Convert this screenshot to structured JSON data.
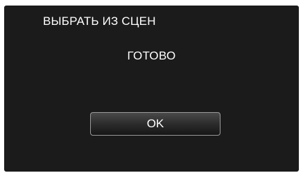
{
  "dialog": {
    "title": "ВЫБРАТЬ ИЗ СЦЕН",
    "status": "ГОТОВО",
    "ok_label": "OK"
  },
  "colors": {
    "background": "#1b1b1b",
    "text": "#ffffff",
    "button_border": "#9a9a9a"
  }
}
